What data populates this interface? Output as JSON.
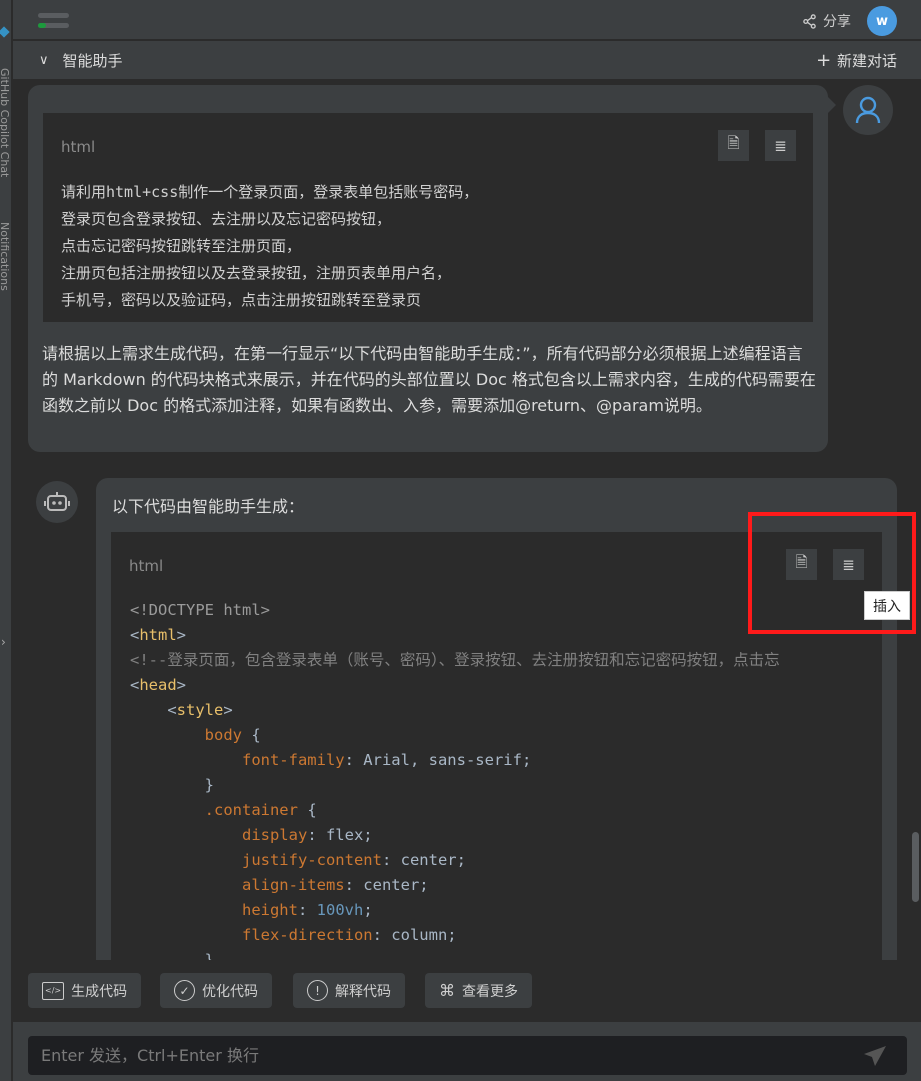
{
  "sidebar": {
    "copilot_label": "GitHub Copilot Chat",
    "notifications_label": "Notifications"
  },
  "header": {
    "share_label": "分享",
    "user_initial": "w",
    "title": "智能助手",
    "new_chat_label": "新建对话"
  },
  "colors": {
    "accent": "#4a9be0",
    "highlight_box": "#ff1a1a",
    "background": "#2b2b2b",
    "panel": "#3c3f41"
  },
  "user_message": {
    "code_lang": "html",
    "code_text": "请利用html+css制作一个登录页面，登录表单包括账号密码，\n登录页包含登录按钮、去注册以及忘记密码按钮，\n点击忘记密码按钮跳转至注册页面，\n注册页包括注册按钮以及去登录按钮，注册页表单用户名，\n手机号，密码以及验证码，点击注册按钮跳转至登录页",
    "text": "请根据以上需求生成代码，在第一行显示“以下代码由智能助手生成：”，所有代码部分必须根据上述编程语言的 Markdown 的代码块格式来展示，并在代码的头部位置以 Doc 格式包含以上需求内容，生成的代码需要在函数之前以 Doc 的格式添加注释，如果有函数出、入参，需要添加@return、@param说明。"
  },
  "bot_message": {
    "intro": "以下代码由智能助手生成：",
    "code_lang": "html",
    "insert_tooltip": "插入",
    "code_lines": [
      [
        [
          "<!DOCTYPE html>",
          "gray"
        ]
      ],
      [
        [
          "<",
          "br"
        ],
        [
          "html",
          "tag"
        ],
        [
          ">",
          "br"
        ]
      ],
      [
        [
          "<!--登录页面，包含登录表单（账号、密码）、登录按钮、去注册按钮和忘记密码按钮，点击忘",
          "cm"
        ]
      ],
      [
        [
          "<",
          "br"
        ],
        [
          "head",
          "tag"
        ],
        [
          ">",
          "br"
        ]
      ],
      [
        [
          "    <",
          "br"
        ],
        [
          "style",
          "tag"
        ],
        [
          ">",
          "br"
        ]
      ],
      [
        [
          "        body",
          "sel"
        ],
        [
          " {",
          "br"
        ]
      ],
      [
        [
          "            font-family",
          "prop"
        ],
        [
          ": Arial, sans-serif;",
          "val"
        ]
      ],
      [
        [
          "        }",
          "br"
        ]
      ],
      [
        [
          "        .container",
          "sel"
        ],
        [
          " {",
          "br"
        ]
      ],
      [
        [
          "            display",
          "prop"
        ],
        [
          ": flex;",
          "val"
        ]
      ],
      [
        [
          "            justify-content",
          "prop"
        ],
        [
          ": center;",
          "val"
        ]
      ],
      [
        [
          "            align-items",
          "prop"
        ],
        [
          ": center;",
          "val"
        ]
      ],
      [
        [
          "            height",
          "prop"
        ],
        [
          ": ",
          "val"
        ],
        [
          "100vh",
          "num"
        ],
        [
          ";",
          "val"
        ]
      ],
      [
        [
          "            flex-direction",
          "prop"
        ],
        [
          ": column;",
          "val"
        ]
      ],
      [
        [
          "        }",
          "br"
        ]
      ]
    ]
  },
  "actions": [
    {
      "label": "生成代码",
      "icon": "code-icon"
    },
    {
      "label": "优化代码",
      "icon": "check-circle-icon"
    },
    {
      "label": "解释代码",
      "icon": "info-circle-icon"
    },
    {
      "label": "查看更多",
      "icon": "grid-icon"
    }
  ],
  "input": {
    "placeholder": "Enter 发送，Ctrl+Enter 换行"
  }
}
